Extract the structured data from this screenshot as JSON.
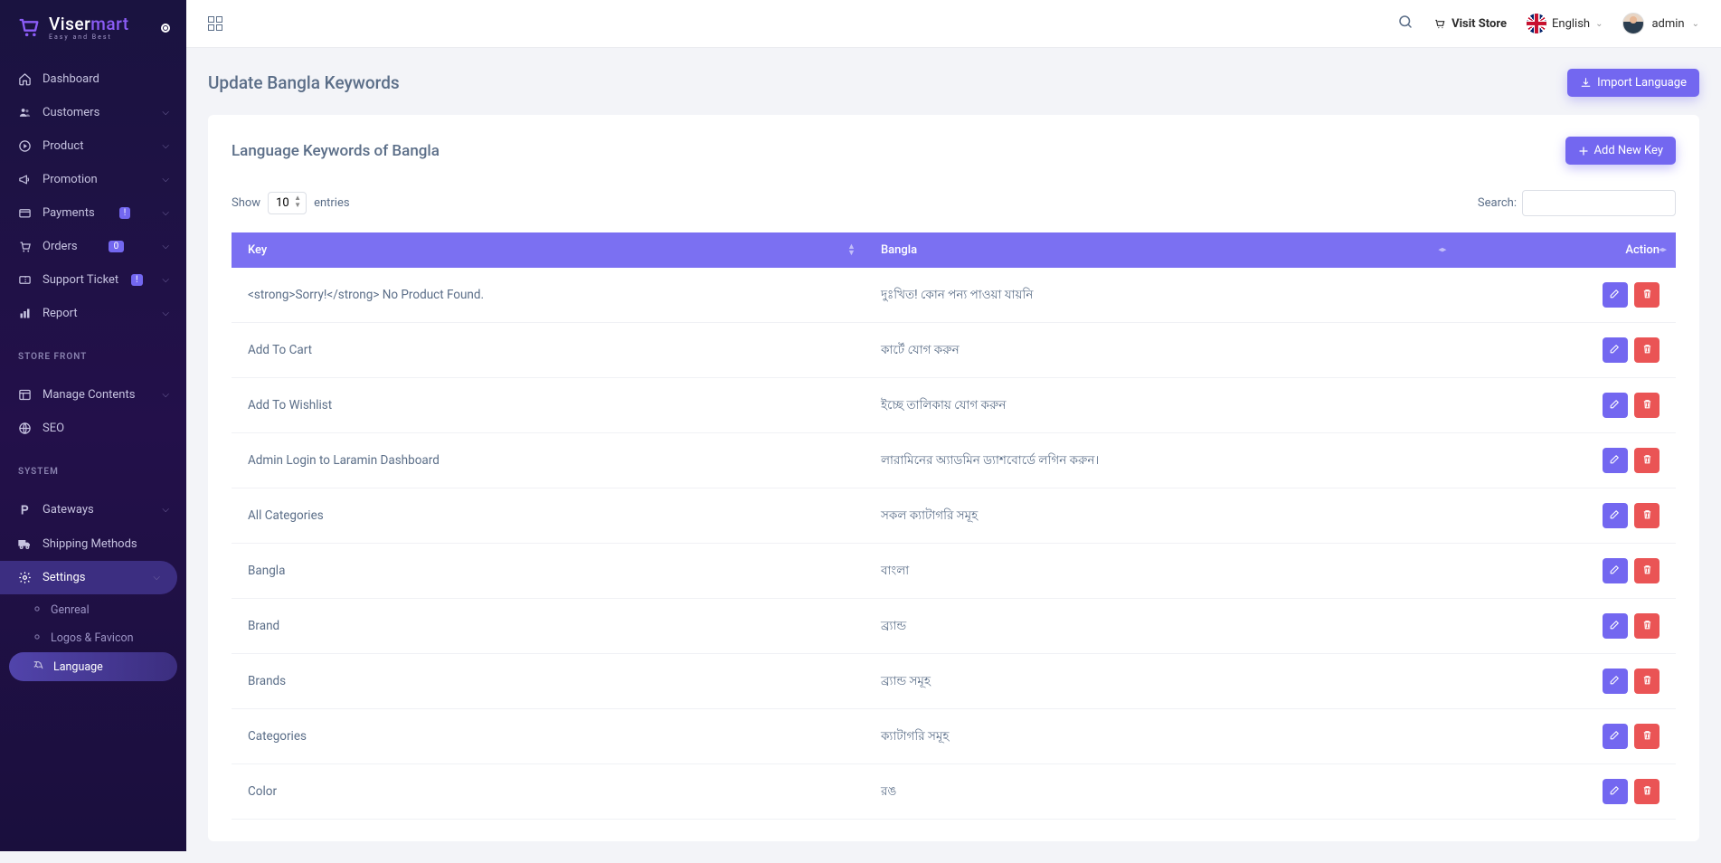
{
  "brand": {
    "name_a": "Viser",
    "name_b": "mart",
    "tagline": "Easy and Best"
  },
  "topbar": {
    "visit_store": "Visit Store",
    "language": "English",
    "username": "admin"
  },
  "sidebar": {
    "items": [
      {
        "label": "Dashboard",
        "icon": "home",
        "chev": false
      },
      {
        "label": "Customers",
        "icon": "users",
        "chev": true
      },
      {
        "label": "Product",
        "icon": "circle-play",
        "chev": true
      },
      {
        "label": "Promotion",
        "icon": "megaphone",
        "chev": true
      },
      {
        "label": "Payments",
        "icon": "card",
        "chev": true,
        "badge": "!"
      },
      {
        "label": "Orders",
        "icon": "cart",
        "chev": true,
        "badge": "0"
      },
      {
        "label": "Support Ticket",
        "icon": "ticket",
        "chev": true,
        "badge": "!"
      },
      {
        "label": "Report",
        "icon": "bar",
        "chev": true
      }
    ],
    "heading_front": "STORE FRONT",
    "front": [
      {
        "label": "Manage Contents",
        "icon": "layout",
        "chev": true
      },
      {
        "label": "SEO",
        "icon": "globe",
        "chev": false
      }
    ],
    "heading_system": "SYSTEM",
    "system": [
      {
        "label": "Gateways",
        "icon": "pay",
        "chev": true
      },
      {
        "label": "Shipping Methods",
        "icon": "truck",
        "chev": false
      },
      {
        "label": "Settings",
        "icon": "gear",
        "chev": true,
        "active": true
      }
    ],
    "settings_sub": [
      {
        "label": "Genreal"
      },
      {
        "label": "Logos & Favicon"
      },
      {
        "label": "Language",
        "active": true
      }
    ]
  },
  "page": {
    "title": "Update Bangla Keywords",
    "import_btn": "Import Language",
    "card_title": "Language Keywords of Bangla",
    "add_btn": "Add New Key",
    "show_label": "Show",
    "entries_label": "entries",
    "entries_value": "10",
    "search_label": "Search:",
    "columns": {
      "key": "Key",
      "bangla": "Bangla",
      "action": "Action"
    }
  },
  "rows": [
    {
      "key": "<strong>Sorry!</strong> No Product Found.",
      "bangla": "দুঃখিত! কোন পন্য পাওয়া যায়নি"
    },
    {
      "key": "Add To Cart",
      "bangla": "কার্টে যোগ করুন"
    },
    {
      "key": "Add To Wishlist",
      "bangla": "ইচ্ছে তালিকায় যোগ করুন"
    },
    {
      "key": "Admin Login to Laramin Dashboard",
      "bangla": "লারামিনের অ্যাডমিন ড্যাশবোর্ডে লগিন করুন।"
    },
    {
      "key": "All Categories",
      "bangla": "সকল ক্যাটাগরি সমূহ"
    },
    {
      "key": "Bangla",
      "bangla": "বাংলা"
    },
    {
      "key": "Brand",
      "bangla": "ব্র্যান্ড"
    },
    {
      "key": "Brands",
      "bangla": "ব্র্যান্ড সমূহ"
    },
    {
      "key": "Categories",
      "bangla": "ক্যাটাগরি সমূহ"
    },
    {
      "key": "Color",
      "bangla": "রঙ"
    }
  ]
}
